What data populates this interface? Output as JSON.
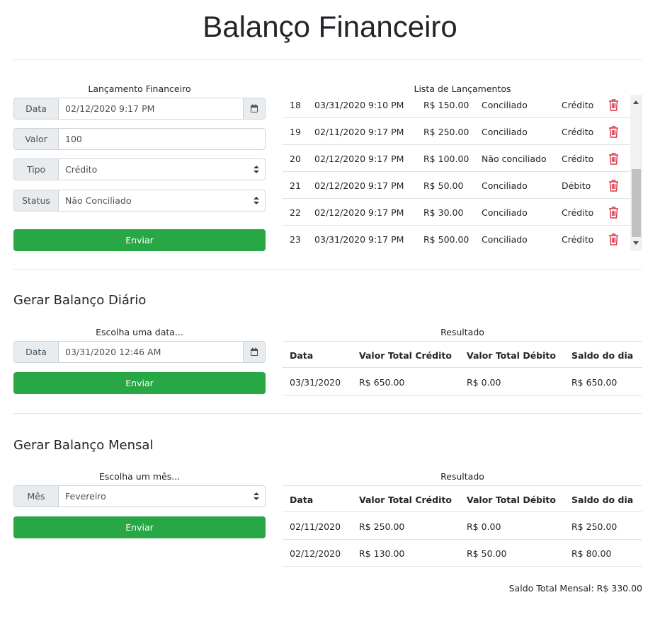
{
  "page_title": "Balanço Financeiro",
  "launch_form": {
    "caption": "Lançamento Financeiro",
    "date_label": "Data",
    "date_value": "02/12/2020 9:17 PM",
    "valor_label": "Valor",
    "valor_value": "100",
    "tipo_label": "Tipo",
    "tipo_value": "Crédito",
    "status_label": "Status",
    "status_value": "Não Conciliado",
    "submit_label": "Enviar"
  },
  "launch_list": {
    "caption": "Lista de Lançamentos",
    "rows": [
      {
        "id": "18",
        "date": "03/31/2020 9:10 PM",
        "amount": "R$ 150.00",
        "status": "Conciliado",
        "type": "Crédito"
      },
      {
        "id": "19",
        "date": "02/11/2020 9:17 PM",
        "amount": "R$ 250.00",
        "status": "Conciliado",
        "type": "Crédito"
      },
      {
        "id": "20",
        "date": "02/12/2020 9:17 PM",
        "amount": "R$ 100.00",
        "status": "Não conciliado",
        "type": "Crédito"
      },
      {
        "id": "21",
        "date": "02/12/2020 9:17 PM",
        "amount": "R$ 50.00",
        "status": "Conciliado",
        "type": "Débito"
      },
      {
        "id": "22",
        "date": "02/12/2020 9:17 PM",
        "amount": "R$ 30.00",
        "status": "Conciliado",
        "type": "Crédito"
      },
      {
        "id": "23",
        "date": "03/31/2020 9:17 PM",
        "amount": "R$ 500.00",
        "status": "Conciliado",
        "type": "Crédito"
      }
    ]
  },
  "daily": {
    "heading": "Gerar Balanço Diário",
    "caption": "Escolha uma data...",
    "date_label": "Data",
    "date_value": "03/31/2020 12:46 AM",
    "submit_label": "Enviar",
    "result_caption": "Resultado",
    "headers": [
      "Data",
      "Valor Total Crédito",
      "Valor Total Débito",
      "Saldo do dia"
    ],
    "rows": [
      [
        "03/31/2020",
        "R$ 650.00",
        "R$ 0.00",
        "R$ 650.00"
      ]
    ]
  },
  "monthly": {
    "heading": "Gerar Balanço Mensal",
    "caption": "Escolha um mês...",
    "month_label": "Mês",
    "month_value": "Fevereiro",
    "submit_label": "Enviar",
    "result_caption": "Resultado",
    "headers": [
      "Data",
      "Valor Total Crédito",
      "Valor Total Débito",
      "Saldo do dia"
    ],
    "rows": [
      [
        "02/11/2020",
        "R$ 250.00",
        "R$ 0.00",
        "R$ 250.00"
      ],
      [
        "02/12/2020",
        "R$ 130.00",
        "R$ 50.00",
        "R$ 80.00"
      ]
    ],
    "total": "Saldo Total Mensal: R$ 330.00"
  },
  "colors": {
    "primary_button": "#28a745",
    "delete_icon": "#dc3545"
  }
}
